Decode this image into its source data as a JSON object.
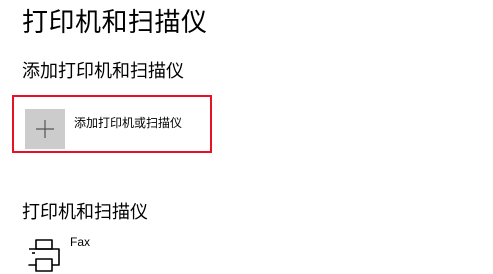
{
  "page": {
    "title": "打印机和扫描仪"
  },
  "add_section": {
    "heading": "添加打印机和扫描仪",
    "add_button_label": "添加打印机或扫描仪",
    "icon": "plus-icon",
    "highlight_color": "#e81123",
    "tile_color": "#cccccc"
  },
  "printers_section": {
    "heading": "打印机和扫描仪",
    "devices": [
      {
        "name": "Fax",
        "icon": "printer-icon"
      }
    ]
  }
}
